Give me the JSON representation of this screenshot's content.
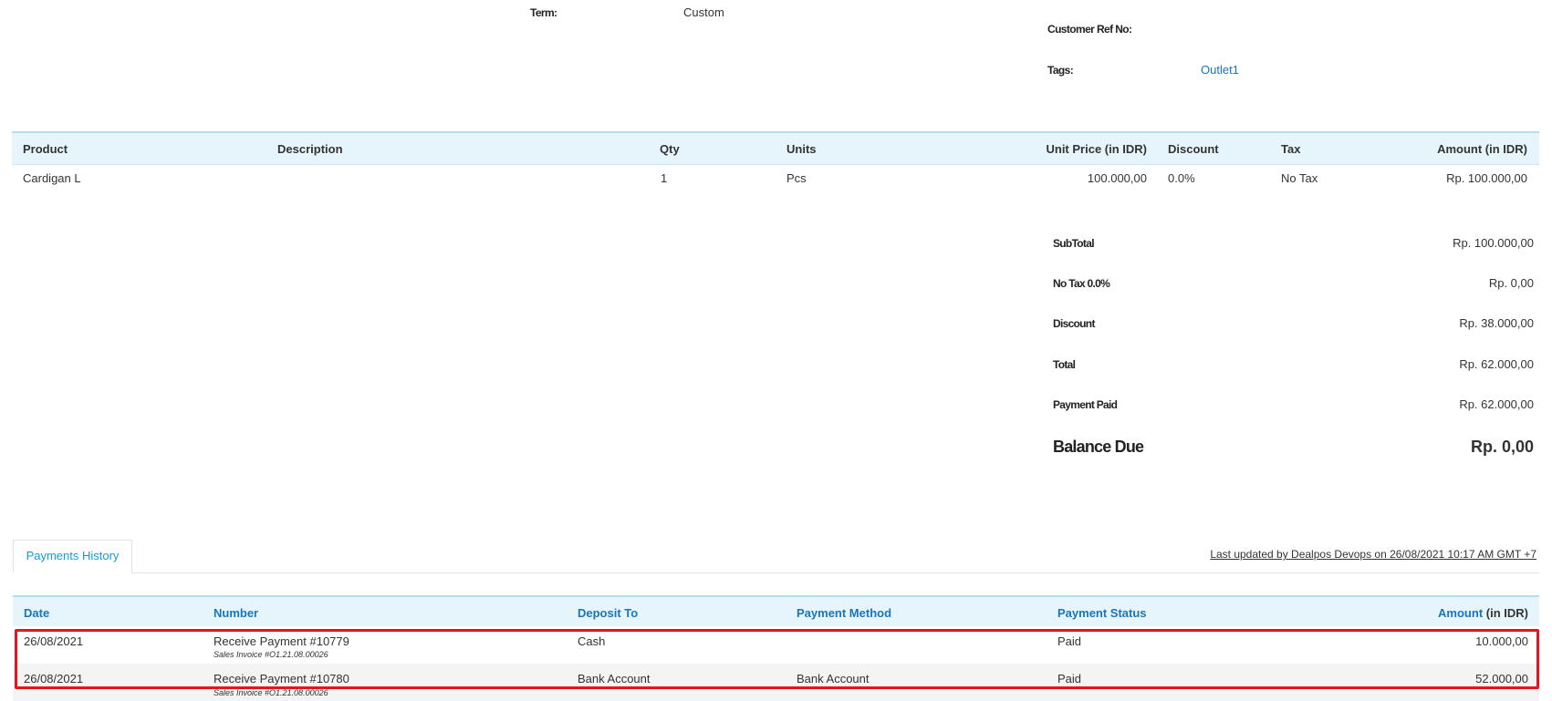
{
  "header": {
    "term_label": "Term:",
    "term_value": "Custom",
    "customer_ref_label": "Customer Ref No:",
    "tags_label": "Tags:",
    "tags_value": "Outlet1"
  },
  "products": {
    "columns": [
      "Product",
      "Description",
      "Qty",
      "Units",
      "Unit Price (in IDR)",
      "Discount",
      "Tax",
      "Amount (in IDR)"
    ],
    "rows": [
      {
        "product": "Cardigan L",
        "description": "",
        "qty": "1",
        "units": "Pcs",
        "unit_price": "100.000,00",
        "discount": "0.0%",
        "tax": "No Tax",
        "amount": "Rp. 100.000,00"
      }
    ]
  },
  "totals": {
    "subtotal_label": "SubTotal",
    "subtotal_value": "Rp. 100.000,00",
    "tax_label": "No Tax 0.0%",
    "tax_value": "Rp. 0,00",
    "discount_label": "Discount",
    "discount_value": "Rp. 38.000,00",
    "total_label": "Total",
    "total_value": "Rp. 62.000,00",
    "paid_label": "Payment Paid",
    "paid_value": "Rp. 62.000,00",
    "balance_label": "Balance Due",
    "balance_value": "Rp. 0,00"
  },
  "tabs": {
    "payments_history": "Payments History",
    "last_updated": "Last updated by Dealpos Devops on 26/08/2021 10:17 AM GMT +7"
  },
  "payments": {
    "columns": [
      "Date",
      "Number",
      "Deposit To",
      "Payment Method",
      "Payment Status",
      "Amount",
      "(in IDR)"
    ],
    "rows": [
      {
        "date": "26/08/2021",
        "number": "Receive Payment #10779",
        "ref": "Sales Invoice #O1.21.08.00026",
        "deposit_to": "Cash",
        "method": "",
        "status": "Paid",
        "amount": "10.000,00"
      },
      {
        "date": "26/08/2021",
        "number": "Receive Payment #10780",
        "ref": "Sales Invoice #O1.21.08.00026",
        "deposit_to": "Bank Account",
        "method": "Bank Account",
        "status": "Paid",
        "amount": "52.000,00"
      }
    ]
  },
  "colors": {
    "link": "#1a75bb",
    "tab_active": "#1a9ad6",
    "header_bg": "#e6f5fb",
    "highlight": "#e8141b"
  }
}
